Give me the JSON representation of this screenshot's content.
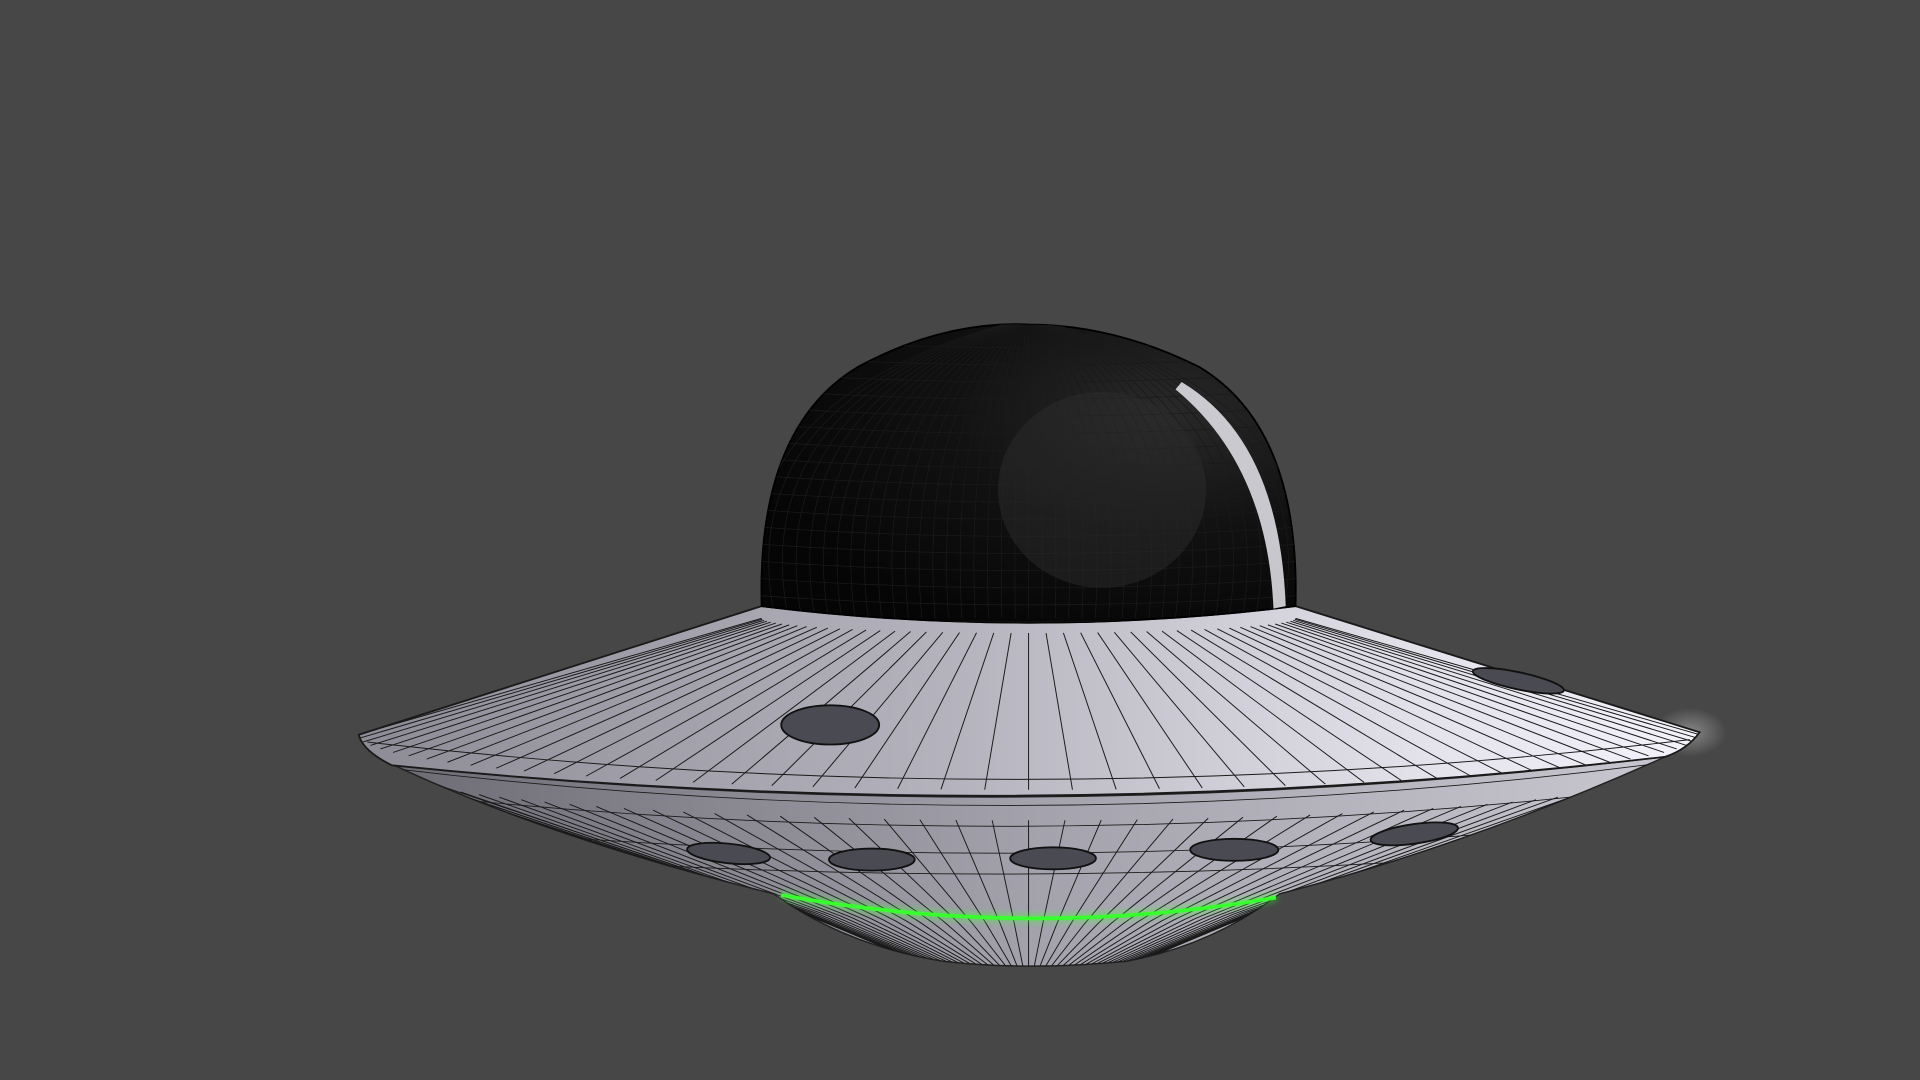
{
  "scene": {
    "subject": "ufo-wireframe-render",
    "colors": {
      "background": "#474747",
      "dome": "#0b0b0b",
      "hull_light": "#ecebf3",
      "hull_dark": "#77767f",
      "wire": "#1a1a1a",
      "glow_ring": "#39ff2e"
    }
  }
}
